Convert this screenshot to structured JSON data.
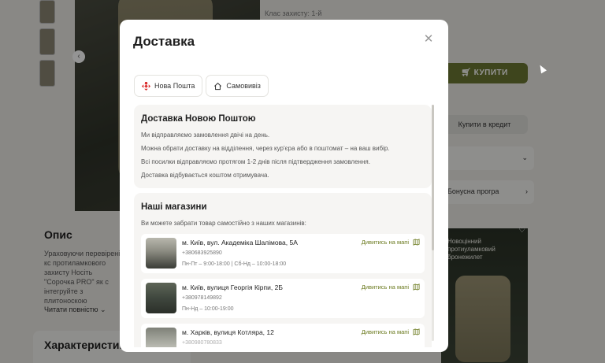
{
  "background": {
    "protection_text": "Клас захисту: 1-й",
    "buy_label": "КУПИТИ",
    "credit_label": "Купити в кредит",
    "bonus_label": "Бонусна програ",
    "description_title": "Опис",
    "description_text": "Ураховуючи перевірені кс протиламкового захисту Носіть \"Сорочка PRO\" як с інтегруйте з плитоноскою",
    "read_more": "Читати повністю",
    "characteristics_title": "Характеристики",
    "promo_text": "Новоцінний протиуламковий бронежилет"
  },
  "modal": {
    "title": "Доставка",
    "tabs": [
      {
        "label": "Нова Пошта",
        "icon": "nova-poshta-icon"
      },
      {
        "label": "Самовивіз",
        "icon": "home-icon"
      }
    ],
    "nova_poshta": {
      "title": "Доставка Новою Поштою",
      "lines": [
        "Ми відправляємо замовлення двічі на день.",
        "Можна обрати доставку на відділення, через кур'єра або в поштомат – на ваш вибір.",
        "Всі посилки відправляємо протягом 1-2 днів після підтвердження замовлення.",
        "Доставка відбувається коштом отримувача."
      ]
    },
    "stores": {
      "title": "Наші магазини",
      "subtitle": "Ви можете забрати товар самостійно з наших магазинів:",
      "map_link": "Дивитись на мапі",
      "items": [
        {
          "address": "м. Київ, вул. Академіка Шалімова, 5А",
          "phone": "+380683925890",
          "hours": "Пн-Пт – 9:00-18:00 | Сб-Нд – 10:00-18:00"
        },
        {
          "address": "м. Київ, вулиця Георгія Кірпи, 2Б",
          "phone": "+380978149892",
          "hours": "Пн-Нд – 10:00-19:00"
        },
        {
          "address": "м. Харків, вулиця Котляра, 12",
          "phone": "+380980780833",
          "hours": ""
        }
      ]
    }
  },
  "colors": {
    "accent": "#6b7a1f",
    "buy_button": "#6b7732",
    "nova_poshta_red": "#da2a2a"
  }
}
